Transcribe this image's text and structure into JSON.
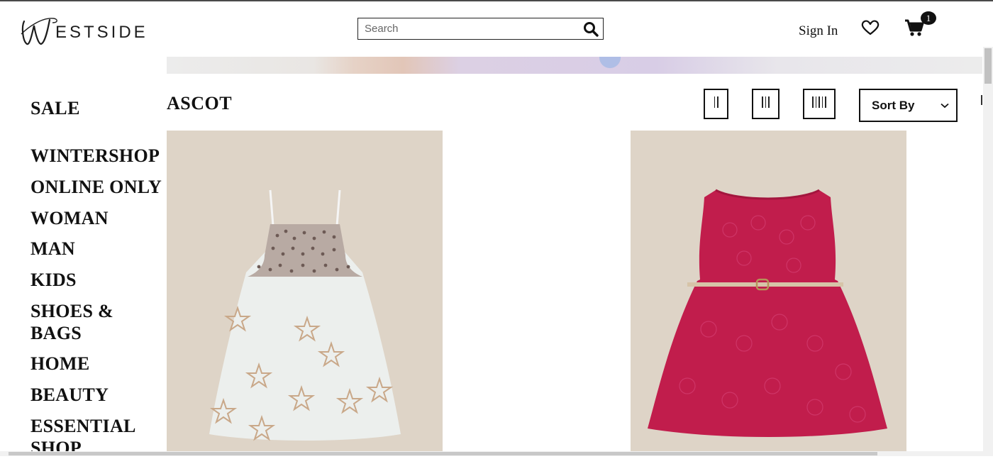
{
  "brand": {
    "name": "ESTSIDE",
    "initial": "W"
  },
  "header": {
    "search_placeholder": "Search",
    "search_value": "",
    "signin_label": "Sign In",
    "cart_count": "1"
  },
  "sidebar": {
    "sale": "SALE",
    "items": [
      {
        "label": "WINTERSHOP"
      },
      {
        "label": "ONLINE ONLY"
      },
      {
        "label": "WOMAN"
      },
      {
        "label": "MAN"
      },
      {
        "label": "KIDS"
      },
      {
        "label": "SHOES &"
      },
      {
        "label": "BAGS"
      },
      {
        "label": "HOME"
      },
      {
        "label": "BEAUTY"
      },
      {
        "label": "ESSENTIAL"
      },
      {
        "label": "SHOP"
      }
    ]
  },
  "listing": {
    "title": "ASCOT",
    "grid_options": [
      "2-column-grid-icon",
      "3-column-grid-icon",
      "5-column-grid-icon"
    ],
    "sort_label": "Sort By"
  },
  "products": [
    {
      "image": "white-sequin-star-dress",
      "bg": "#ded4c7"
    },
    {
      "image": "red-belted-lace-dress",
      "bg": "#ded4c7"
    }
  ],
  "colors": {
    "text": "#111111",
    "border": "#222222",
    "dress_red": "#c11d4c"
  }
}
